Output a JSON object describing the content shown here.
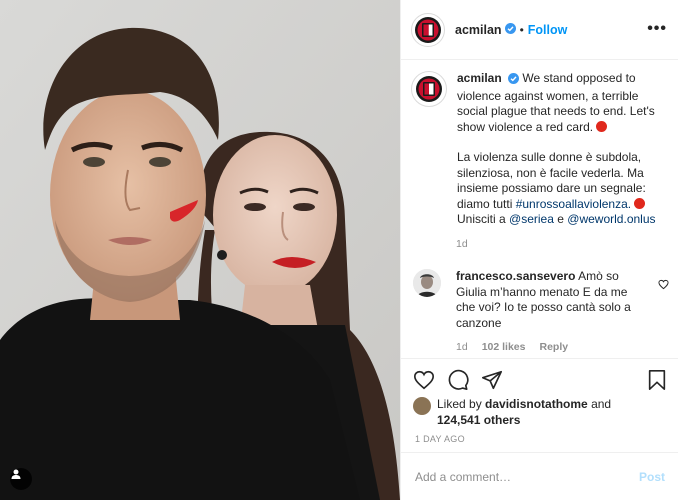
{
  "header": {
    "username": "acmilan",
    "separator": "•",
    "follow_label": "Follow",
    "more_label": "•••"
  },
  "caption": {
    "username": "acmilan",
    "text_en": "We stand opposed to violence against women, a terrible social plague that needs to end. Let's show violence a red card.",
    "text_it_1": "La violenza sulle donne è subdola, silenziosa, non è facile vederla. Ma insieme possiamo dare un segnale: diamo tutti",
    "hashtag": "#unrossoallaviolenza.",
    "text_it_2": "Unisciti a",
    "mention_1": "@seriea",
    "conjunction": "e",
    "mention_2": "@weworld.onlus",
    "time": "1d"
  },
  "comment": {
    "username": "francesco.sansevero",
    "text": "Amò so Giulia m’hanno menato E da me che voi? Io te posso cantà solo a canzone",
    "time": "1d",
    "likes": "102 likes",
    "reply_label": "Reply"
  },
  "likes": {
    "prefix": "Liked by",
    "user": "davidisnotathome",
    "conjunction": "and",
    "others": "124,541 others"
  },
  "time_ago": "1 DAY AGO",
  "add_comment": {
    "placeholder": "Add a comment…",
    "post_label": "Post"
  },
  "icons": {
    "verified": "verified-badge-icon",
    "heart": "heart-icon",
    "comment": "comment-icon",
    "share": "share-icon",
    "save": "bookmark-icon",
    "tag": "user-tag-icon"
  },
  "colors": {
    "link": "#0095f6",
    "hashtag": "#00376b",
    "red_card": "#e0281c",
    "milan_red": "#c8102e"
  }
}
